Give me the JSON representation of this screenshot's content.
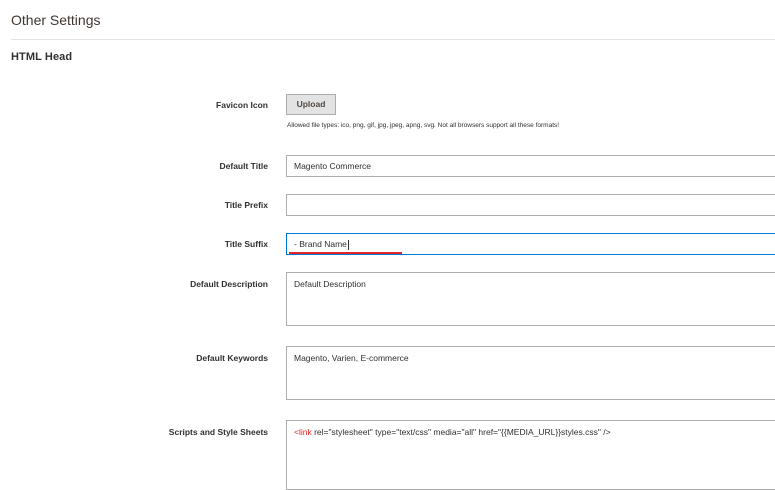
{
  "section": {
    "title": "Other Settings",
    "group_title": "HTML Head"
  },
  "fields": {
    "favicon": {
      "label": "Favicon Icon",
      "button": "Upload",
      "note": "Allowed file types: ico, png, gif, jpg, jpeg, apng, svg. Not all browsers support all these formats!"
    },
    "default_title": {
      "label": "Default Title",
      "value": "Magento Commerce"
    },
    "title_prefix": {
      "label": "Title Prefix",
      "value": ""
    },
    "title_suffix": {
      "label": "Title Suffix",
      "value": "- Brand Name"
    },
    "default_description": {
      "label": "Default Description",
      "value": "Default Description"
    },
    "default_keywords": {
      "label": "Default Keywords",
      "value": "Magento, Varien, E-commerce"
    },
    "scripts": {
      "label": "Scripts and Style Sheets",
      "value_tag": "<link",
      "value_rest": " rel=\"stylesheet\" type=\"text/css\"  media=\"all\" href=\"{{MEDIA_URL}}styles.css\" />"
    }
  },
  "colors": {
    "accent_focus": "#007bdb",
    "annotation_red": "#e22626",
    "border": "#adadad"
  }
}
